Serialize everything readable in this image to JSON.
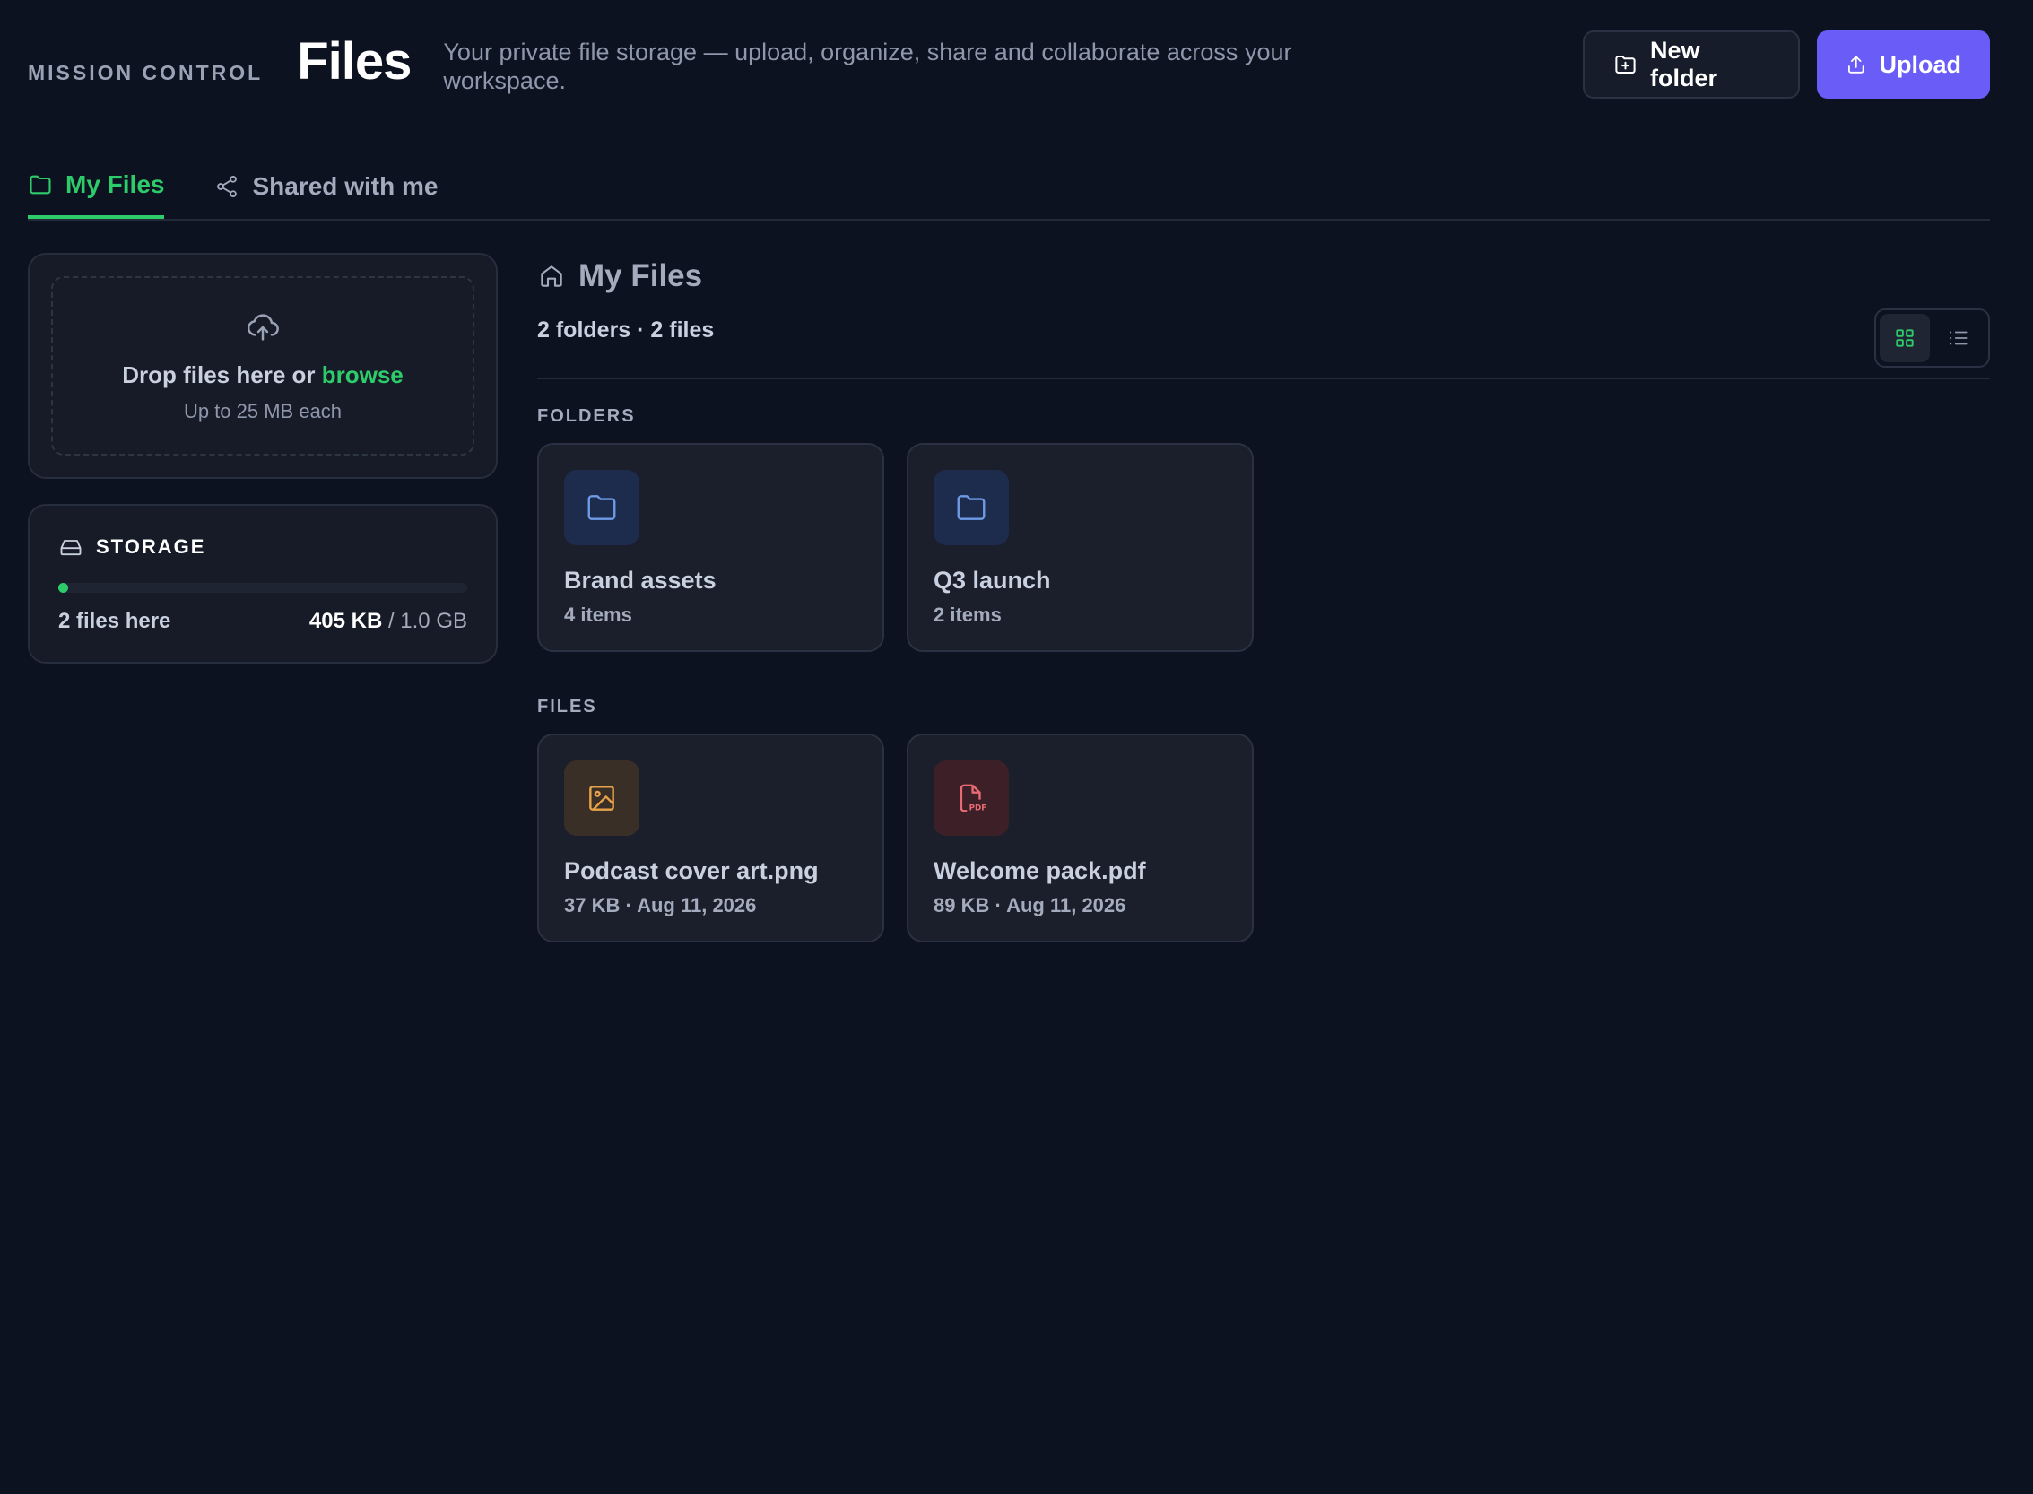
{
  "header": {
    "brand": "MISSION CONTROL",
    "title": "Files",
    "subtitle": "Your private file storage — upload, organize, share and collaborate across your workspace.",
    "new_folder_label": "New folder",
    "upload_label": "Upload"
  },
  "tabs": [
    {
      "label": "My Files",
      "active": true,
      "icon": "folder-icon"
    },
    {
      "label": "Shared with me",
      "active": false,
      "icon": "share-icon"
    }
  ],
  "dropzone": {
    "text": "Drop files here or ",
    "browse": "browse",
    "hint": "Up to 25 MB each",
    "icon": "cloud-upload-icon"
  },
  "storage": {
    "heading": "STORAGE",
    "files_here": "2 files here",
    "used": "405 KB",
    "total": " / 1.0 GB",
    "used_fraction": 0.0004
  },
  "main": {
    "crumb": "My Files",
    "counts": "2 folders · 2 files",
    "view_mode": "grid"
  },
  "sections": {
    "folders_title": "FOLDERS",
    "files_title": "FILES"
  },
  "folders": [
    {
      "name": "Brand assets",
      "meta": "4 items"
    },
    {
      "name": "Q3 launch",
      "meta": "2 items"
    }
  ],
  "files": [
    {
      "name": "Podcast cover art.png",
      "meta": "37 KB · Aug 11, 2026",
      "type": "image"
    },
    {
      "name": "Welcome pack.pdf",
      "meta": "89 KB · Aug 11, 2026",
      "type": "pdf"
    }
  ],
  "colors": {
    "background": "#0c1220",
    "accent_green": "#2ecb6a",
    "primary_button": "#6a5cf6",
    "card": "#1a1f2b"
  }
}
